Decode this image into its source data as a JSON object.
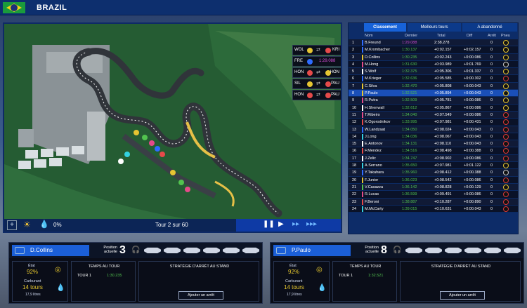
{
  "header": {
    "title": "BRAZIL"
  },
  "map": {
    "rain": "0%",
    "lap": "Tour 2 sur 60",
    "battles": [
      {
        "left": "WOL",
        "right": "KRI",
        "gap": ""
      },
      {
        "left": "FRE",
        "right": "",
        "gap": "1:29.088"
      },
      {
        "left": "HON",
        "right": "HON",
        "gap": ""
      },
      {
        "left": "SIL",
        "right": "PAU",
        "gap": ""
      },
      {
        "left": "HON",
        "right": "PAU",
        "gap": ""
      }
    ]
  },
  "standings": {
    "tabs": [
      "Classement",
      "Meilleurs tours",
      "A abandonné"
    ],
    "columns": [
      "Nom",
      "Dernier",
      "Total",
      "Diff",
      "Arrêt",
      "Pneu"
    ],
    "rows": [
      {
        "pos": "1",
        "name": "B.Freund",
        "best": "1:29.088",
        "total": "2:38.278",
        "diff": "",
        "stop": "0",
        "tyre": "m",
        "color": "#2e6cff",
        "purple": true
      },
      {
        "pos": "2",
        "name": "M.Krombacher",
        "best": "1:30.137",
        "total": "+0:02.157",
        "diff": "+0:02.157",
        "stop": "0",
        "tyre": "m",
        "color": "#2e6cff"
      },
      {
        "pos": "3",
        "name": "D.Collins",
        "best": "1:30.235",
        "total": "+0:02.243",
        "diff": "+0:00.086",
        "stop": "0",
        "tyre": "m",
        "color": "#e6c532"
      },
      {
        "pos": "4",
        "name": "M.Hong",
        "best": "1:31.630",
        "total": "+0:03.989",
        "diff": "+0:01.769",
        "stop": "0",
        "tyre": "h",
        "color": "#e64a8a"
      },
      {
        "pos": "5",
        "name": "S.Wolf",
        "best": "1:32.375",
        "total": "+0:05.306",
        "diff": "+0:01.337",
        "stop": "0",
        "tyre": "m",
        "color": "#ffffff"
      },
      {
        "pos": "6",
        "name": "M.Krieger",
        "best": "1:32.636",
        "total": "+0:05.585",
        "diff": "+0:00.302",
        "stop": "0",
        "tyre": "s",
        "color": "#2e6cff"
      },
      {
        "pos": "7",
        "name": "C.Silva",
        "best": "1:32.470",
        "total": "+0:05.808",
        "diff": "+0:00.043",
        "stop": "0",
        "tyre": "m",
        "color": "#e6c532"
      },
      {
        "pos": "8",
        "name": "P.Paulo",
        "best": "1:32.521",
        "total": "+0:05.894",
        "diff": "+0:00.043",
        "stop": "0",
        "tyre": "m",
        "color": "#e6c532",
        "hl": true
      },
      {
        "pos": "9",
        "name": "R.Putra",
        "best": "1:32.509",
        "total": "+0:05.781",
        "diff": "+0:00.086",
        "stop": "0",
        "tyre": "m",
        "color": "#e64a8a"
      },
      {
        "pos": "10",
        "name": "H.Shenwall",
        "best": "1:32.612",
        "total": "+0:05.867",
        "diff": "+0:00.086",
        "stop": "0",
        "tyre": "m",
        "color": "#ffffff"
      },
      {
        "pos": "11",
        "name": "T.Ribeiro",
        "best": "1:34.040",
        "total": "+0:07.549",
        "diff": "+0:00.086",
        "stop": "0",
        "tyre": "s",
        "color": "#e64a8a"
      },
      {
        "pos": "12",
        "name": "K.Ogorodnikov",
        "best": "1:33.995",
        "total": "+0:07.981",
        "diff": "+0:00.431",
        "stop": "0",
        "tyre": "s",
        "color": "#e64a4a"
      },
      {
        "pos": "13",
        "name": "W.Landzaat",
        "best": "1:34.050",
        "total": "+0:08.024",
        "diff": "+0:00.043",
        "stop": "0",
        "tyre": "s",
        "color": "#2e6cff"
      },
      {
        "pos": "14",
        "name": "J.Long",
        "best": "1:34.036",
        "total": "+0:08.067",
        "diff": "+0:00.043",
        "stop": "0",
        "tyre": "s",
        "color": "#33d0e0"
      },
      {
        "pos": "15",
        "name": "E.Antonov",
        "best": "1:34.131",
        "total": "+0:08.110",
        "diff": "+0:00.043",
        "stop": "0",
        "tyre": "s",
        "color": "#ffffff"
      },
      {
        "pos": "16",
        "name": "F.Mendez",
        "best": "1:34.516",
        "total": "+0:08.498",
        "diff": "+0:00.388",
        "stop": "0",
        "tyre": "s",
        "color": "#e64a4a"
      },
      {
        "pos": "17",
        "name": "J.Zelic",
        "best": "1:34.747",
        "total": "+0:08.902",
        "diff": "+0:00.086",
        "stop": "0",
        "tyre": "s",
        "color": "#ffffff"
      },
      {
        "pos": "18",
        "name": "A.Serrano",
        "best": "1:35.650",
        "total": "+0:07.981",
        "diff": "+0:01.122",
        "stop": "0",
        "tyre": "m",
        "color": "#33d0e0"
      },
      {
        "pos": "19",
        "name": "Y.Takahara",
        "best": "1:35.960",
        "total": "+0:08.412",
        "diff": "+0:00.388",
        "stop": "0",
        "tyre": "h",
        "color": "#2e6cff"
      },
      {
        "pos": "20",
        "name": "F.Junior",
        "best": "1:36.023",
        "total": "+0:08.542",
        "diff": "+0:00.086",
        "stop": "0",
        "tyre": "s",
        "color": "#e6c532"
      },
      {
        "pos": "21",
        "name": "V.Casazza",
        "best": "1:36.142",
        "total": "+0:08.828",
        "diff": "+0:00.129",
        "stop": "0",
        "tyre": "m",
        "color": "#52c34f"
      },
      {
        "pos": "22",
        "name": "R.Lucas",
        "best": "1:36.599",
        "total": "+0:09.491",
        "diff": "+0:00.086",
        "stop": "0",
        "tyre": "s",
        "color": "#e64a8a"
      },
      {
        "pos": "23",
        "name": "F.Beroni",
        "best": "1:38.887",
        "total": "+0:10.287",
        "diff": "+0:00.890",
        "stop": "0",
        "tyre": "s",
        "color": "#e64a4a"
      },
      {
        "pos": "24",
        "name": "M.McCarty",
        "best": "1:39.015",
        "total": "+0:10.631",
        "diff": "+0:00.043",
        "stop": "0",
        "tyre": "s",
        "color": "#33d0e0"
      }
    ]
  },
  "driver1": {
    "name": "D.Collins",
    "pos_label_1": "Position",
    "pos_label_2": "actuelle",
    "pos": "3",
    "state_label": "État",
    "state": "92%",
    "fuel_label": "Carburant",
    "fuel": "14 tours",
    "fuel_litres": "17,9 litres",
    "lap_header": "TEMPS AU TOUR",
    "lap_label": "TOUR 1",
    "lap_time": "1:30.235",
    "strategy_header": "STRATÉGIE D'ARRÊT AU STAND",
    "add_stop": "Ajouter un arrêt"
  },
  "driver2": {
    "name": "P.Paulo",
    "pos_label_1": "Position",
    "pos_label_2": "actuelle",
    "pos": "8",
    "state_label": "État",
    "state": "92%",
    "fuel_label": "Carburant",
    "fuel": "14 tours",
    "fuel_litres": "17,9 litres",
    "lap_header": "TEMPS AU TOUR",
    "lap_label": "TOUR 1",
    "lap_time": "1:32.521",
    "strategy_header": "STRATÉGIE D'ARRÊT AU STAND",
    "add_stop": "Ajouter un arrêt"
  }
}
